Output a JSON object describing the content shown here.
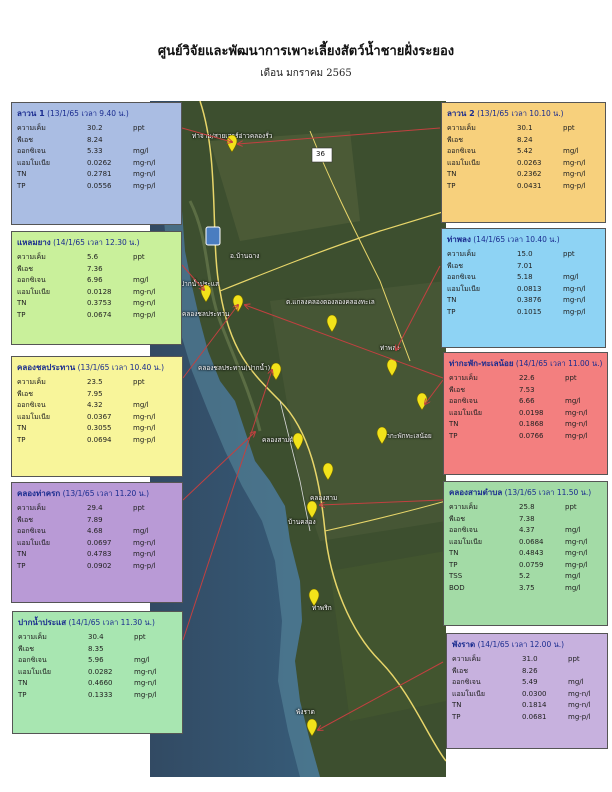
{
  "header": {
    "title": "ศูนย์วิจัยและพัฒนาการเพาะเลี้ยงสัตว์น้ำชายฝั่งระยอง",
    "subtitle": "เดือน มกราคม 2565"
  },
  "colors": {
    "sea": "#2f4f70",
    "land": "#3b4d2e",
    "road": "#e8d66a",
    "pin": "#f2e21a",
    "arrow": "#c24040"
  },
  "map_labels": {
    "top": "ท่าจาม/สายเสาร์อ่าวคลองรั่ว",
    "n331": "36",
    "town1": "อ.บ้านฉาง",
    "l1": "ปากน้ำประแส",
    "l2": "คลองชลประทาน",
    "center": "ต.แกลงคลองตองลองคลองทะเล",
    "l3": "ท่าพลง",
    "l4": "คลองชลประทาน(ปากน้ำ)",
    "l5": "ท่ากะพักทะเลน้อย",
    "l6": "คลองสามด้าน",
    "l7": "พังราด",
    "l8": "บ้านคลอง",
    "l9": "คลองสาม",
    "l10": "ท่าพริก",
    "l11": "พังราด"
  },
  "stations": [
    {
      "name": "ลาวน 1",
      "meta": "(13/1/65 เวลา 9.40 น.)",
      "bg": "#aabde3",
      "rows": [
        {
          "p": "ความเค็ม",
          "v": "30.2",
          "u": "ppt"
        },
        {
          "p": "พีเอช",
          "v": "8.24",
          "u": ""
        },
        {
          "p": "ออกซิเจน",
          "v": "5.33",
          "u": "mg/l"
        },
        {
          "p": "แอมโมเนีย",
          "v": "0.0262",
          "u": "mg-n/l"
        },
        {
          "p": "TN",
          "v": "0.2781",
          "u": "mg-n/l"
        },
        {
          "p": "TP",
          "v": "0.0556",
          "u": "mg-p/l"
        }
      ]
    },
    {
      "name": "ลาวน 2",
      "meta": "(13/1/65 เวลา 10.10 น.)",
      "bg": "#f7d07c",
      "rows": [
        {
          "p": "ความเค็ม",
          "v": "30.1",
          "u": "ppt"
        },
        {
          "p": "พีเอช",
          "v": "8.24",
          "u": ""
        },
        {
          "p": "ออกซิเจน",
          "v": "5.42",
          "u": "mg/l"
        },
        {
          "p": "แอมโมเนีย",
          "v": "0.0263",
          "u": "mg-n/l"
        },
        {
          "p": "TN",
          "v": "0.2362",
          "u": "mg-n/l"
        },
        {
          "p": "TP",
          "v": "0.0431",
          "u": "mg-p/l"
        }
      ]
    },
    {
      "name": "แหลมยาง",
      "meta": "(14/1/65 เวลา 12.30 น.)",
      "bg": "#c9f09b",
      "rows": [
        {
          "p": "ความเค็ม",
          "v": "5.6",
          "u": "ppt"
        },
        {
          "p": "พีเอช",
          "v": "7.36",
          "u": ""
        },
        {
          "p": "ออกซิเจน",
          "v": "6.96",
          "u": "mg/l"
        },
        {
          "p": "แอมโมเนีย",
          "v": "0.0128",
          "u": "mg-n/l"
        },
        {
          "p": "TN",
          "v": "0.3753",
          "u": "mg-n/l"
        },
        {
          "p": "TP",
          "v": "0.0674",
          "u": "mg-p/l"
        }
      ]
    },
    {
      "name": "ท่าพลง",
      "meta": "(14/1/65 เวลา 10.40 น.)",
      "bg": "#8ed3f4",
      "rows": [
        {
          "p": "ความเค็ม",
          "v": "15.0",
          "u": "ppt"
        },
        {
          "p": "พีเอช",
          "v": "7.01",
          "u": ""
        },
        {
          "p": "ออกซิเจน",
          "v": "5.18",
          "u": "mg/l"
        },
        {
          "p": "แอมโมเนีย",
          "v": "0.0813",
          "u": "mg-n/l"
        },
        {
          "p": "TN",
          "v": "0.3876",
          "u": "mg-n/l"
        },
        {
          "p": "TP",
          "v": "0.1015",
          "u": "mg-p/l"
        }
      ]
    },
    {
      "name": "คลองชลประทาน",
      "meta": "(13/1/65 เวลา 10.40 น.)",
      "bg": "#f8f59a",
      "rows": [
        {
          "p": "ความเค็ม",
          "v": "23.5",
          "u": "ppt"
        },
        {
          "p": "พีเอช",
          "v": "7.95",
          "u": ""
        },
        {
          "p": "ออกซิเจน",
          "v": "4.32",
          "u": "mg/l"
        },
        {
          "p": "แอมโมเนีย",
          "v": "0.0367",
          "u": "mg-n/l"
        },
        {
          "p": "TN",
          "v": "0.3055",
          "u": "mg-n/l"
        },
        {
          "p": "TP",
          "v": "0.0694",
          "u": "mg-p/l"
        }
      ]
    },
    {
      "name": "ท่ากะพัก-ทะเลน้อย",
      "meta": "(14/1/65 เวลา 11.00 น.)",
      "bg": "#f37f7f",
      "rows": [
        {
          "p": "ความเค็ม",
          "v": "22.6",
          "u": "ppt"
        },
        {
          "p": "พีเอช",
          "v": "7.53",
          "u": ""
        },
        {
          "p": "ออกซิเจน",
          "v": "6.66",
          "u": "mg/l"
        },
        {
          "p": "แอมโมเนีย",
          "v": "0.0198",
          "u": "mg-n/l"
        },
        {
          "p": "TN",
          "v": "0.1868",
          "u": "mg-n/l"
        },
        {
          "p": "TP",
          "v": "0.0766",
          "u": "mg-p/l"
        }
      ]
    },
    {
      "name": "คลองท่าครก",
      "meta": "(13/1/65 เวลา 11.20 น.)",
      "bg": "#b99ad6",
      "rows": [
        {
          "p": "ความเค็ม",
          "v": "29.4",
          "u": "ppt"
        },
        {
          "p": "พีเอช",
          "v": "7.89",
          "u": ""
        },
        {
          "p": "ออกซิเจน",
          "v": "4.68",
          "u": "mg/l"
        },
        {
          "p": "แอมโมเนีย",
          "v": "0.0697",
          "u": "mg-n/l"
        },
        {
          "p": "TN",
          "v": "0.4783",
          "u": "mg-n/l"
        },
        {
          "p": "TP",
          "v": "0.0902",
          "u": "mg-p/l"
        }
      ]
    },
    {
      "name": "คลองสามตำบล",
      "meta": "(13/1/65 เวลา 11.50 น.)",
      "bg": "#a3dba6",
      "rows": [
        {
          "p": "ความเค็ม",
          "v": "25.8",
          "u": "ppt"
        },
        {
          "p": "พีเอช",
          "v": "7.38",
          "u": ""
        },
        {
          "p": "ออกซิเจน",
          "v": "4.37",
          "u": "mg/l"
        },
        {
          "p": "แอมโมเนีย",
          "v": "0.0684",
          "u": "mg-n/l"
        },
        {
          "p": "TN",
          "v": "0.4843",
          "u": "mg-n/l"
        },
        {
          "p": "TP",
          "v": "0.0759",
          "u": "mg-p/l"
        },
        {
          "p": "TSS",
          "v": "5.2",
          "u": "mg/l"
        },
        {
          "p": "BOD",
          "v": "3.75",
          "u": "mg/l"
        }
      ]
    },
    {
      "name": "ปากน้ำประแส",
      "meta": "(14/1/65 เวลา 11.30 น.)",
      "bg": "#a8e6b1",
      "rows": [
        {
          "p": "ความเค็ม",
          "v": "30.4",
          "u": "ppt"
        },
        {
          "p": "พีเอช",
          "v": "8.35",
          "u": ""
        },
        {
          "p": "ออกซิเจน",
          "v": "5.96",
          "u": "mg/l"
        },
        {
          "p": "แอมโมเนีย",
          "v": "0.0282",
          "u": "mg-n/l"
        },
        {
          "p": "TN",
          "v": "0.4660",
          "u": "mg-n/l"
        },
        {
          "p": "TP",
          "v": "0.1333",
          "u": "mg-p/l"
        }
      ]
    },
    {
      "name": "พังราด",
      "meta": "(14/1/65 เวลา 12.00 น.)",
      "bg": "#c7b1de",
      "rows": [
        {
          "p": "ความเค็ม",
          "v": "31.0",
          "u": "ppt"
        },
        {
          "p": "พีเอช",
          "v": "8.26",
          "u": ""
        },
        {
          "p": "ออกซิเจน",
          "v": "5.49",
          "u": "mg/l"
        },
        {
          "p": "แอมโมเนีย",
          "v": "0.0300",
          "u": "mg-n/l"
        },
        {
          "p": "TN",
          "v": "0.1814",
          "u": "mg-n/l"
        },
        {
          "p": "TP",
          "v": "0.0681",
          "u": "mg-p/l"
        }
      ]
    }
  ]
}
